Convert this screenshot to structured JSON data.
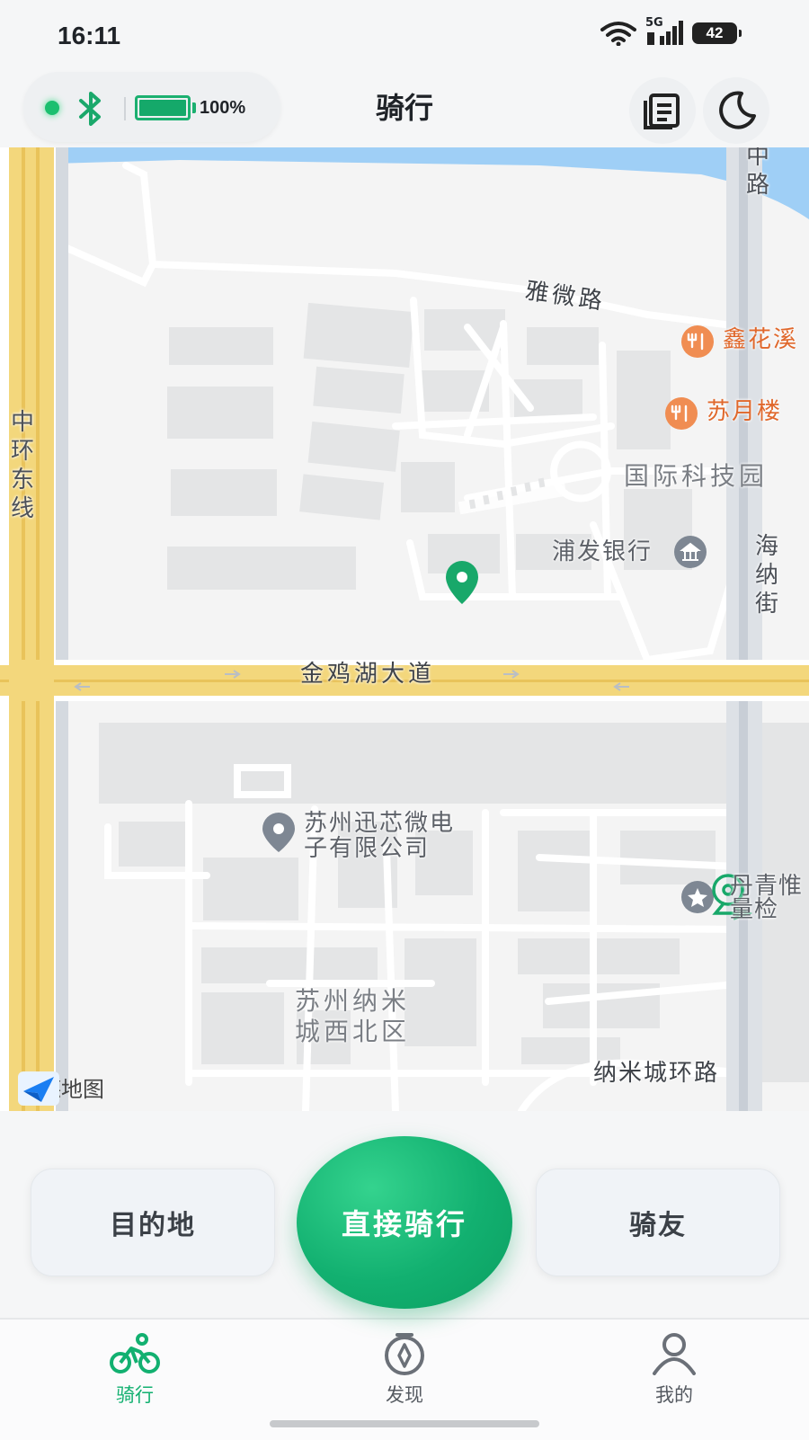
{
  "status_bar": {
    "time": "16:11",
    "network": "5G",
    "battery": "42"
  },
  "header": {
    "title": "骑行",
    "device": {
      "battery_text": "100%",
      "battery_level": 1.0,
      "connected": true
    },
    "left_icons": [
      "bluetooth-icon"
    ],
    "right_icons": [
      "records-icon",
      "moon-icon"
    ]
  },
  "map": {
    "road_labels": {
      "yawei": "雅微路",
      "jinjihu": "金鸡湖大道",
      "nanocity": "纳米城环路"
    },
    "vertical_labels": {
      "zhonghuan": "中环东线",
      "zhong_lu": "中路",
      "haina": "海纳街"
    },
    "pois": {
      "xinhuaxi": "鑫花溪",
      "suyuelou": "苏月楼",
      "park": "国际科技园",
      "bank": "浦发银行",
      "company_line1": "苏州迅芯微电",
      "company_line2": "子有限公司",
      "district_line1": "苏州纳米",
      "district_line2": "城西北区",
      "qing_line1": "丹青惟",
      "qing_line2": "量检"
    },
    "attribution": "高德地图"
  },
  "actions": {
    "destination": "目的地",
    "ride_now": "直接骑行",
    "riders": "骑友"
  },
  "bottom_nav": [
    {
      "label": "骑行",
      "icon": "bike-icon",
      "active": true
    },
    {
      "label": "发现",
      "icon": "compass-icon",
      "active": false
    },
    {
      "label": "我的",
      "icon": "profile-icon",
      "active": false
    }
  ],
  "colors": {
    "accent": "#12b070",
    "map_road_major": "#f3d77c",
    "map_block": "#e4e5e6",
    "water": "#9fcff6"
  }
}
